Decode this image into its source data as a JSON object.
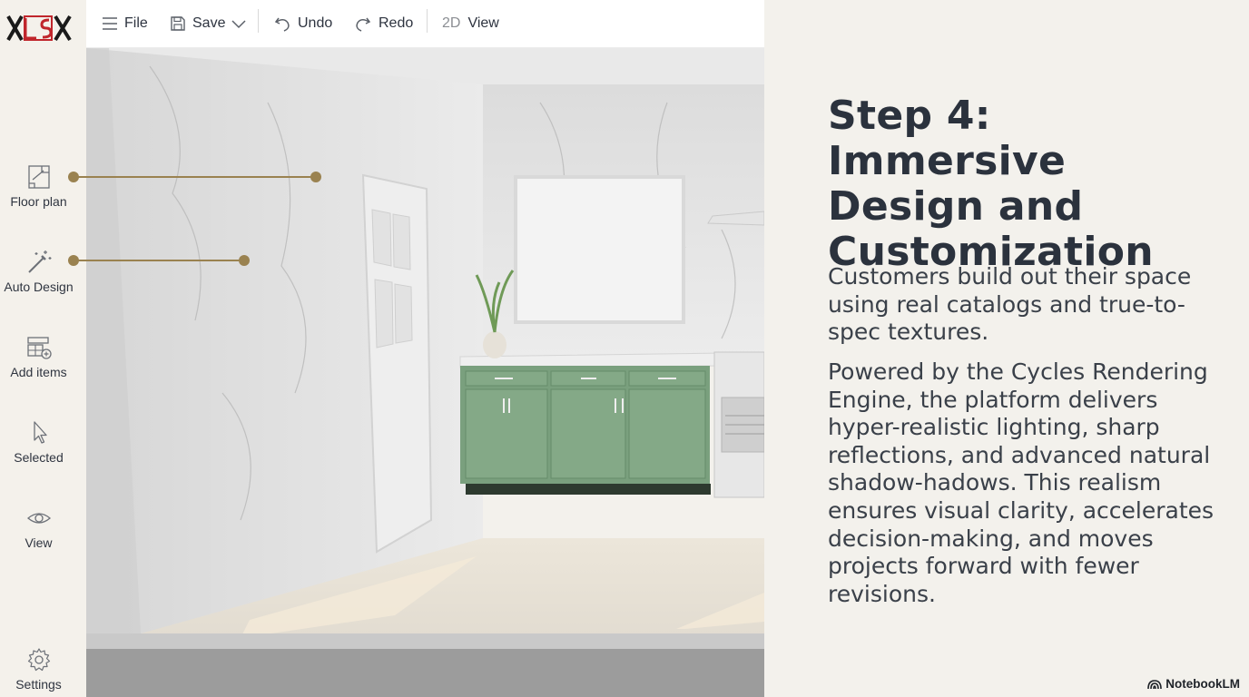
{
  "app": {
    "logo_text": "XLSX"
  },
  "toolbar": {
    "file_label": "File",
    "save_label": "Save",
    "undo_label": "Undo",
    "redo_label": "Redo",
    "view_prefix": "2D",
    "view_label": "View"
  },
  "sidebar": {
    "items": [
      {
        "label": "Floor plan",
        "icon": "floor-plan-icon"
      },
      {
        "label": "Auto Design",
        "icon": "magic-wand-icon"
      },
      {
        "label": "Add items",
        "icon": "add-items-icon"
      },
      {
        "label": "Selected",
        "icon": "cursor-icon"
      },
      {
        "label": "View",
        "icon": "eye-icon"
      },
      {
        "label": "Settings",
        "icon": "gear-icon"
      }
    ]
  },
  "slide": {
    "title": "Step 4: Immersive Design and Customization",
    "paragraph1": "Customers build out their space using real catalogs and true-to-spec textures.",
    "paragraph2": "Powered by the Cycles Rendering Engine, the platform delivers hyper-realistic lighting, sharp reflections, and advanced natural shadow-hadows. This realism ensures visual clarity, accelerates decision-making, and moves projects forward with fewer revisions."
  },
  "branding": {
    "label": "NotebookLM"
  },
  "colors": {
    "accent_gold": "#9a8250",
    "cabinet_green": "#7aa07e",
    "logo_red": "#c0262c"
  }
}
